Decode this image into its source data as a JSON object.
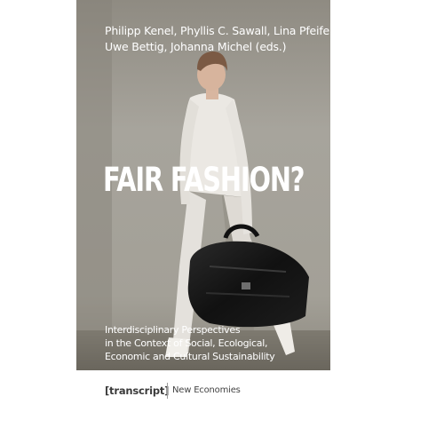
{
  "book": {
    "authors_line1": "Philipp Kenel, Phyllis C. Sawall, Lina Pfeifer,",
    "authors_line2": "Uwe Bettig, Johanna Michel (eds.)",
    "title": "FAIR FASHION?",
    "subtitle_line1": "Interdisciplinary Perspectives",
    "subtitle_line2": "in the Context of Social, Ecological,",
    "subtitle_line3": "Economic and Cultural Sustainability",
    "publisher": "[transcript]",
    "series": "New Economies"
  },
  "colors": {
    "background": "#ffffff",
    "wall": "#a29f97",
    "cover_text": "#ffffff",
    "publisher_text": "#3b3b3b"
  },
  "cover_image": {
    "description_icon": "photo-of-model-with-black-handbag"
  }
}
